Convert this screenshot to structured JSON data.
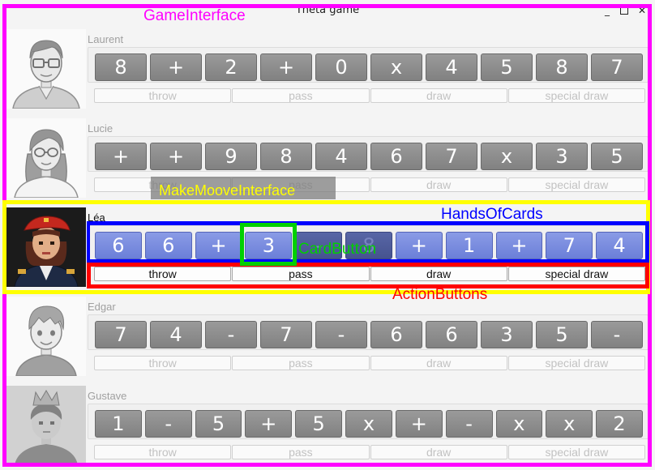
{
  "window": {
    "title": "Theta game",
    "minimize": "_",
    "close": "✕"
  },
  "players": [
    {
      "name": "Laurent",
      "avatar_icon": "man-glasses-avatar",
      "active": false,
      "cards": [
        "8",
        "+",
        "2",
        "+",
        "0",
        "x",
        "4",
        "5",
        "8",
        "7"
      ],
      "actions": [
        "throw",
        "pass",
        "draw",
        "special draw"
      ]
    },
    {
      "name": "Lucie",
      "avatar_icon": "woman-glasses-avatar",
      "active": false,
      "cards": [
        "+",
        "+",
        "9",
        "8",
        "4",
        "6",
        "7",
        "x",
        "3",
        "5"
      ],
      "actions": [
        "throw",
        "pass",
        "draw",
        "special draw"
      ]
    },
    {
      "name": "Léa",
      "avatar_icon": "pixel-woman-beret-avatar",
      "active": true,
      "cards": [
        "6",
        "6",
        "+",
        "3",
        "-",
        "8",
        "+",
        "1",
        "+",
        "7",
        "4"
      ],
      "actions": [
        "throw",
        "pass",
        "draw",
        "special draw"
      ]
    },
    {
      "name": "Edgar",
      "avatar_icon": "boy-avatar",
      "active": false,
      "cards": [
        "7",
        "4",
        "-",
        "7",
        "-",
        "6",
        "6",
        "3",
        "5",
        "-"
      ],
      "actions": [
        "throw",
        "pass",
        "draw",
        "special draw"
      ]
    },
    {
      "name": "Gustave",
      "avatar_icon": "crowned-boy-avatar",
      "active": false,
      "cards": [
        "1",
        "-",
        "5",
        "+",
        "5",
        "x",
        "+",
        "-",
        "x",
        "x",
        "2"
      ],
      "actions": [
        "throw",
        "pass",
        "draw",
        "special draw"
      ]
    }
  ],
  "annotations": {
    "game_interface": {
      "label": "GameInterface",
      "color": "#ff00ff"
    },
    "make_move_interface": {
      "label": "MakeMooveInterface",
      "color": "#ffff00"
    },
    "hands_of_cards": {
      "label": "HandsOfCards",
      "color": "#0000ff"
    },
    "card_button": {
      "label": "CardButton",
      "color": "#00d000"
    },
    "action_buttons": {
      "label": "ActionButtons",
      "color": "#ff0000"
    }
  }
}
